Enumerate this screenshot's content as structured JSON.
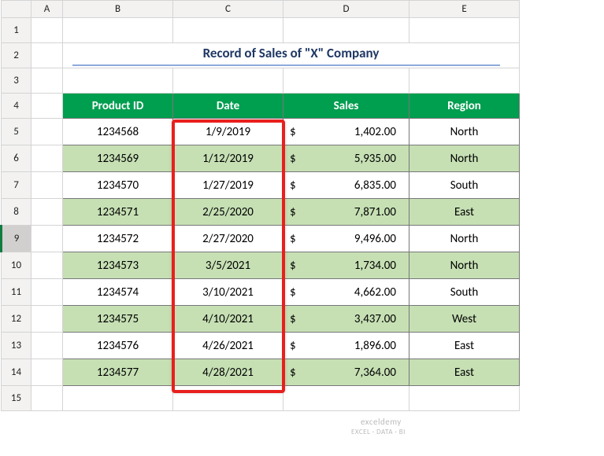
{
  "columns": [
    "A",
    "B",
    "C",
    "D",
    "E"
  ],
  "rows": [
    "1",
    "2",
    "3",
    "4",
    "5",
    "6",
    "7",
    "8",
    "9",
    "10",
    "11",
    "12",
    "13",
    "14",
    "15"
  ],
  "selectedRow": "9",
  "title": "Record of Sales of \"X\" Company",
  "headers": {
    "b": "Product ID",
    "c": "Date",
    "d": "Sales",
    "e": "Region"
  },
  "currency": "$",
  "data": [
    {
      "id": "1234568",
      "date": "1/9/2019",
      "sales": "1,402.00",
      "region": "North"
    },
    {
      "id": "1234569",
      "date": "1/12/2019",
      "sales": "5,935.00",
      "region": "North"
    },
    {
      "id": "1234570",
      "date": "1/27/2019",
      "sales": "6,835.00",
      "region": "South"
    },
    {
      "id": "1234571",
      "date": "2/25/2020",
      "sales": "7,871.00",
      "region": "East"
    },
    {
      "id": "1234572",
      "date": "2/27/2020",
      "sales": "9,496.00",
      "region": "North"
    },
    {
      "id": "1234573",
      "date": "3/5/2021",
      "sales": "1,734.00",
      "region": "North"
    },
    {
      "id": "1234574",
      "date": "3/10/2021",
      "sales": "4,662.00",
      "region": "South"
    },
    {
      "id": "1234575",
      "date": "4/10/2021",
      "sales": "3,437.00",
      "region": "West"
    },
    {
      "id": "1234576",
      "date": "4/26/2021",
      "sales": "1,896.00",
      "region": "East"
    },
    {
      "id": "1234577",
      "date": "4/28/2021",
      "sales": "7,364.00",
      "region": "East"
    }
  ],
  "watermark": {
    "line1": "exceldemy",
    "line2": "EXCEL · DATA · BI"
  }
}
